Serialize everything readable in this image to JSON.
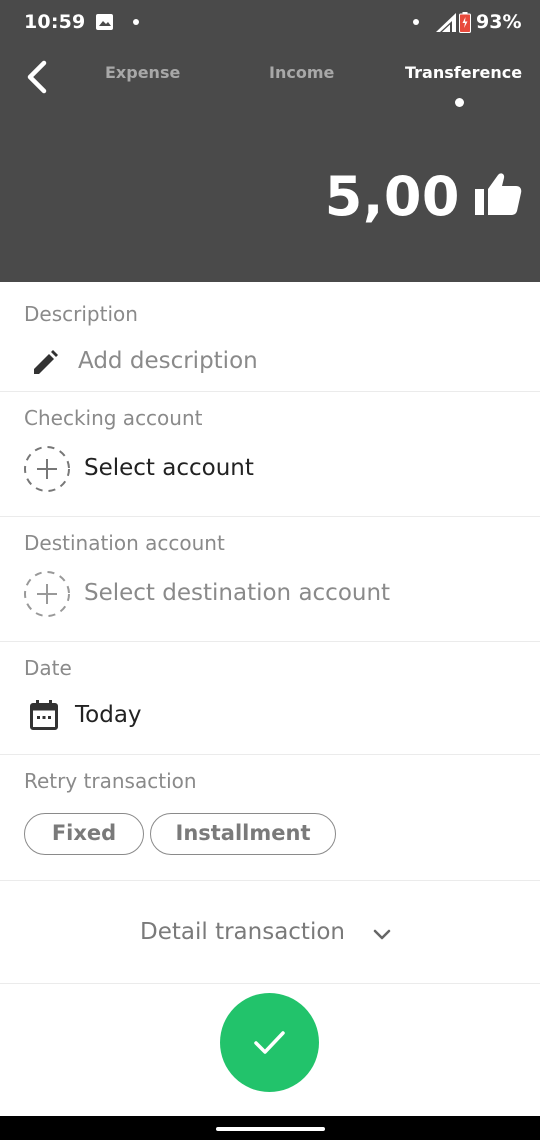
{
  "status_bar": {
    "time": "10:59",
    "battery_percent": "93%"
  },
  "tabs": [
    {
      "label": "Expense"
    },
    {
      "label": "Income"
    },
    {
      "label": "Transference",
      "active": true
    }
  ],
  "amount": "5,00",
  "sections": {
    "description": {
      "label": "Description",
      "placeholder": "Add description"
    },
    "checking": {
      "label": "Checking account",
      "value": "Select account"
    },
    "destination": {
      "label": "Destination account",
      "value": "Select destination account"
    },
    "date": {
      "label": "Date",
      "value": "Today"
    },
    "retry": {
      "label": "Retry transaction",
      "options": [
        "Fixed",
        "Installment"
      ]
    }
  },
  "detail": {
    "label": "Detail transaction"
  },
  "colors": {
    "header_bg": "#4a4a4a",
    "accent_green": "#22c36b"
  },
  "icons": [
    "back-arrow-icon",
    "thumbs-up-icon",
    "pencil-icon",
    "add-circle-dashed-icon",
    "calendar-icon",
    "chevron-down-icon",
    "checkmark-icon"
  ]
}
